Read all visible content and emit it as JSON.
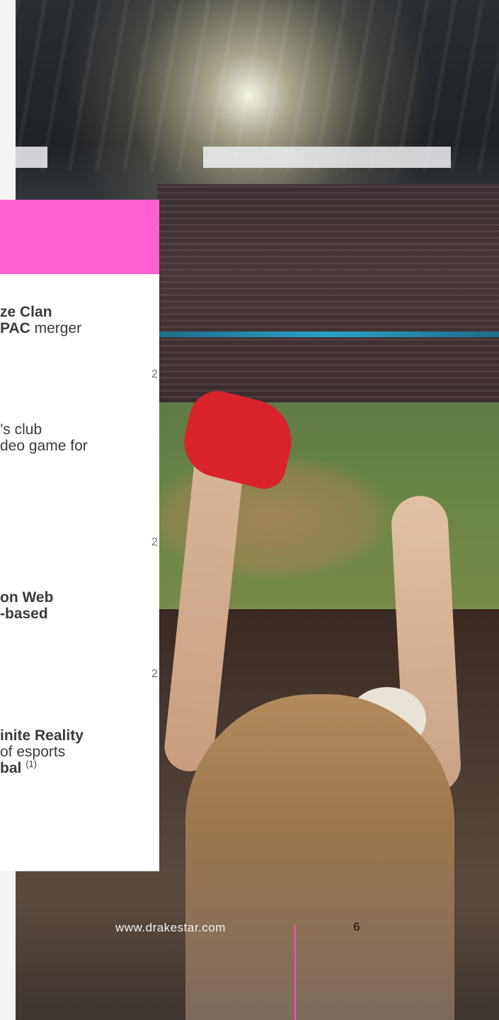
{
  "entries": [
    {
      "lines": [
        [
          {
            "t": "ze Clan",
            "b": true
          }
        ],
        [
          {
            "t": "PAC",
            "b": true
          },
          {
            "t": " merger",
            "b": false
          }
        ]
      ],
      "year": "2"
    },
    {
      "lines": [
        [
          {
            "t": "’s club",
            "b": false
          }
        ],
        [
          {
            "t": "deo game for",
            "b": false
          }
        ]
      ],
      "year": "2"
    },
    {
      "lines": [
        [
          {
            "t": "on Web",
            "b": true
          }
        ],
        [
          {
            "t": "-based",
            "b": true
          }
        ]
      ],
      "year": "2"
    },
    {
      "lines": [
        [
          {
            "t": "inite Reality",
            "b": true
          }
        ],
        [
          {
            "t": " of esports",
            "b": false
          }
        ],
        [
          {
            "t": "bal",
            "b": true
          }
        ]
      ],
      "superscript": "(1)"
    }
  ],
  "footer": {
    "website": "www.drakestar.com",
    "page_number": "6"
  },
  "colors": {
    "accent_pink": "#ff5fcf",
    "divider_pink": "#ff4fb8",
    "card_bg": "#ffffff",
    "text_dark": "#3b3b3b"
  }
}
